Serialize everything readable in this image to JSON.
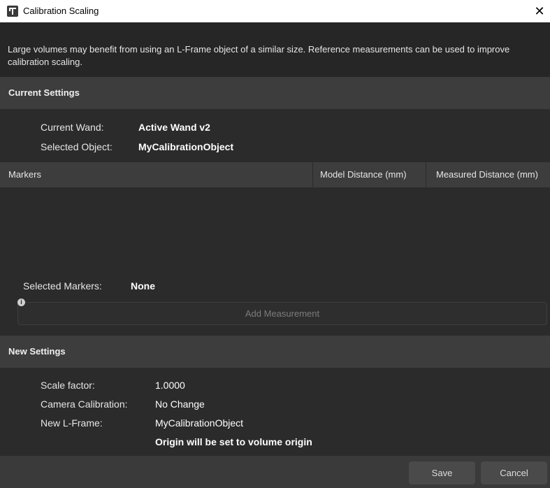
{
  "window": {
    "title": "Calibration Scaling",
    "close_glyph": "✕"
  },
  "intro": "Large volumes may benefit from using an L-Frame object of a similar size. Reference measurements can be used to improve calibration scaling.",
  "current_settings": {
    "header": "Current Settings",
    "wand_label": "Current Wand:",
    "wand_value": "Active Wand v2",
    "object_label": "Selected Object:",
    "object_value": "MyCalibrationObject"
  },
  "markers_table": {
    "columns": [
      "Markers",
      "Model Distance (mm)",
      "Measured Distance (mm)"
    ],
    "rows": []
  },
  "selected_markers": {
    "label": "Selected Markers:",
    "value": "None"
  },
  "info_glyph": "i",
  "add_measurement_label": "Add Measurement",
  "new_settings": {
    "header": "New Settings",
    "scale_label": "Scale factor:",
    "scale_value": "1.0000",
    "camcal_label": "Camera Calibration:",
    "camcal_value": "No Change",
    "lframe_label": "New L-Frame:",
    "lframe_value": "MyCalibrationObject",
    "origin_note": "Origin will be set to volume origin"
  },
  "buttons": {
    "save": "Save",
    "cancel": "Cancel"
  },
  "colors": {
    "background": "#2b2b2b",
    "section_header": "#3d3d3d",
    "titlebar": "#ffffff"
  },
  "icons": {
    "app": "app-logo-icon",
    "close": "close-icon",
    "info": "info-icon"
  }
}
